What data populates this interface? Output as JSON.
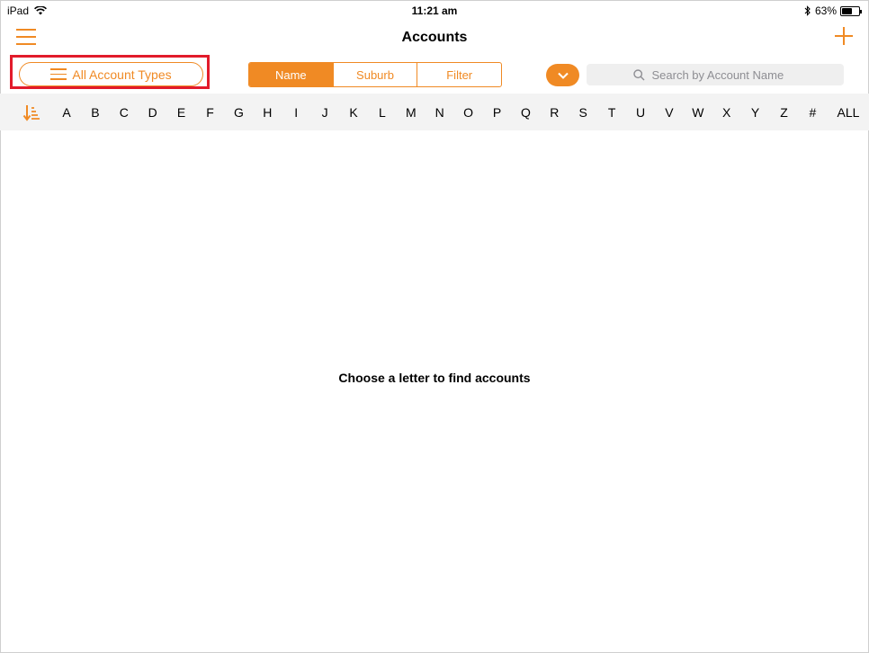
{
  "status": {
    "device": "iPad",
    "time": "11:21 am",
    "battery": "63%",
    "battery_level": 0.63,
    "icons": [
      "wifi-icon",
      "bluetooth-icon",
      "battery-icon"
    ]
  },
  "nav": {
    "title": "Accounts",
    "icons": [
      "menu-icon",
      "add-icon"
    ]
  },
  "toolbar": {
    "account_types_label": "All Account Types",
    "segments": [
      "Name",
      "Suburb",
      "Filter"
    ],
    "selected_segment": "Name",
    "search_placeholder": "Search by Account Name"
  },
  "alphabet": [
    "A",
    "B",
    "C",
    "D",
    "E",
    "F",
    "G",
    "H",
    "I",
    "J",
    "K",
    "L",
    "M",
    "N",
    "O",
    "P",
    "Q",
    "R",
    "S",
    "T",
    "U",
    "V",
    "W",
    "X",
    "Y",
    "Z",
    "#",
    "ALL"
  ],
  "main": {
    "empty_message": "Choose a letter to find accounts"
  },
  "colors": {
    "accent": "#f08a24",
    "highlight": "#e21b2b",
    "alpha_bar_bg": "#f3f3f3",
    "search_bg": "#efefef"
  }
}
